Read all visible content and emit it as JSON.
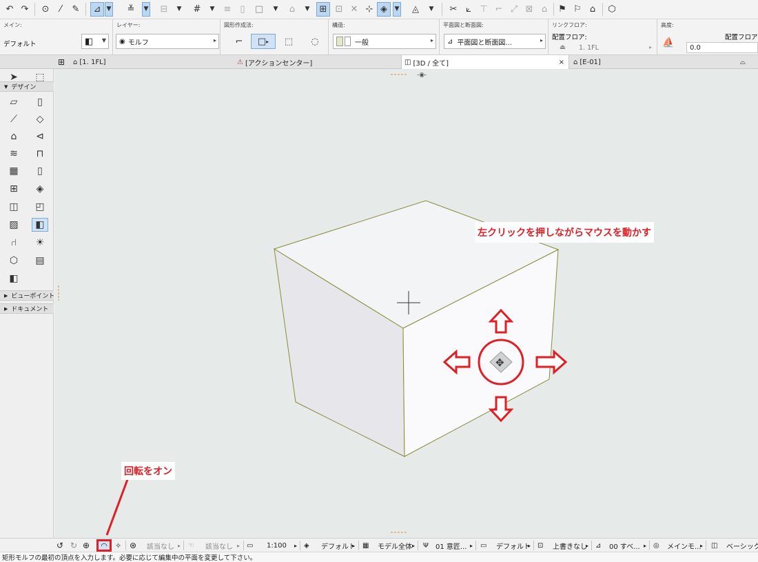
{
  "toolbar": {
    "icons": [
      "undo-icon",
      "redo-icon",
      "pick-parameters-icon",
      "eyedropper-icon",
      "syringe-icon",
      "guide-lines-icon",
      "snap-guides-icon",
      "pet-palette-icon",
      "grid-snap-icon",
      "trace-icon",
      "layer-icon",
      "marquee-icon",
      "layout-icon",
      "gravity-icon",
      "morph-icon",
      "split-icon",
      "adjust-icon",
      "elevation-icon",
      "fillet-icon",
      "offset-icon",
      "flag-icon",
      "show-icon"
    ]
  },
  "infobox": {
    "main": {
      "title": "メイン:",
      "value": "デフォルト"
    },
    "layer": {
      "title": "レイヤー:",
      "value": "モルフ"
    },
    "geometry": {
      "title": "図形作成法:"
    },
    "structure": {
      "title": "構造:",
      "value": "一般"
    },
    "floorplan": {
      "title": "平面図と断面図:",
      "value": "平面図と断面図..."
    },
    "linked_floor": {
      "title": "リンクフロア:",
      "label": "配置フロア:",
      "value": "1. 1FL"
    },
    "height": {
      "title": "高度:",
      "label": "配置フロア",
      "value": "0.0"
    }
  },
  "tabs": [
    {
      "label": "[1. 1FL]"
    },
    {
      "label": "[アクションセンター]"
    },
    {
      "label": "[3D / 全て]",
      "close": "×"
    },
    {
      "label": "[E-01]"
    }
  ],
  "palette": {
    "design_label": "デザイン",
    "viewpoint_label": "ビューポイント",
    "document_label": "ドキュメント"
  },
  "annotations": {
    "drag_hint": "左クリックを押しながらマウスを動かす",
    "orbit_hint": "回転をオン"
  },
  "statusbar": {
    "no_target_1": "該当なし",
    "no_target_2": "該当なし",
    "scale": "1:100",
    "layer_combo": "デフォルト",
    "model_view": "モデル全体",
    "pen_set": "01 意匠...",
    "dimension": "デフォルト",
    "override": "上書きなし",
    "renovation": "00 すべ...",
    "mvo": "メインモ...",
    "engine": "ベーシック"
  },
  "prompt": "矩形モルフの最初の頂点を入力します。必要に応じて編集中の平面を変更して下さい。",
  "colors": {
    "accent": "#e01e25",
    "edge": "#8a8a3a"
  }
}
